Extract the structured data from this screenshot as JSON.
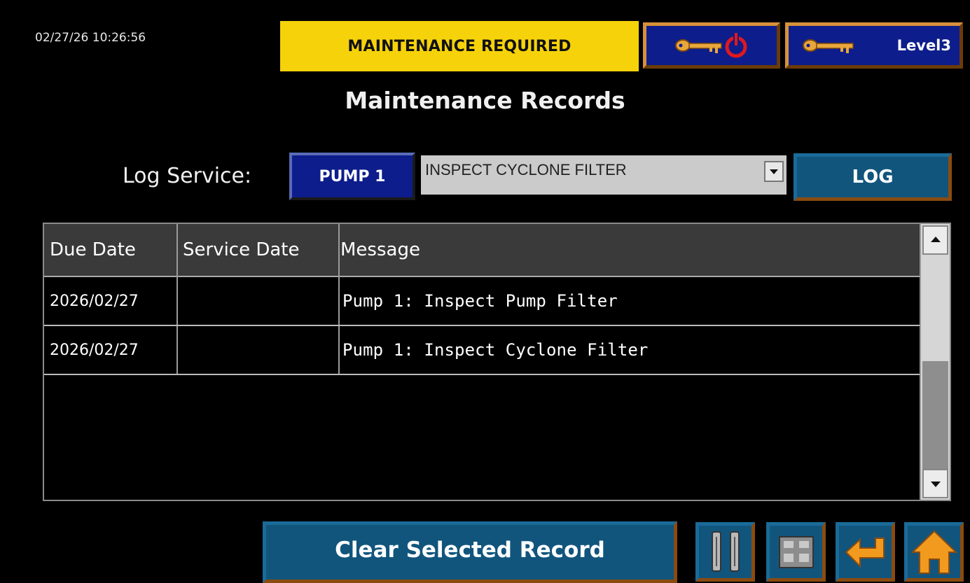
{
  "header": {
    "datetime": "02/27/26 10:26:56",
    "alarm_banner": "MAINTENANCE REQUIRED",
    "logout_icon": "key-power-icon",
    "user_level": "Level3",
    "user_level_icon": "key-icon"
  },
  "page_title": "Maintenance Records",
  "log_service": {
    "label": "Log Service:",
    "pump_button": "PUMP 1",
    "selected_service": "INSPECT CYCLONE FILTER",
    "log_button": "LOG"
  },
  "table": {
    "columns": [
      "Due Date",
      "Service Date",
      "Message"
    ],
    "rows": [
      {
        "due_date": "2026/02/27",
        "service_date": "",
        "message": "Pump 1: Inspect Pump Filter"
      },
      {
        "due_date": "2026/02/27",
        "service_date": "",
        "message": "Pump 1: Inspect Cyclone Filter"
      }
    ]
  },
  "footer": {
    "clear_button": "Clear Selected Record",
    "nav_icons": [
      "pumps-icon",
      "valves-icon",
      "back-arrow-icon",
      "home-icon"
    ]
  },
  "colors": {
    "banner": "#f6d20a",
    "button_blue": "#11557d",
    "header_navy": "#0d1d8c",
    "frame_orange": "#8a4b10"
  }
}
